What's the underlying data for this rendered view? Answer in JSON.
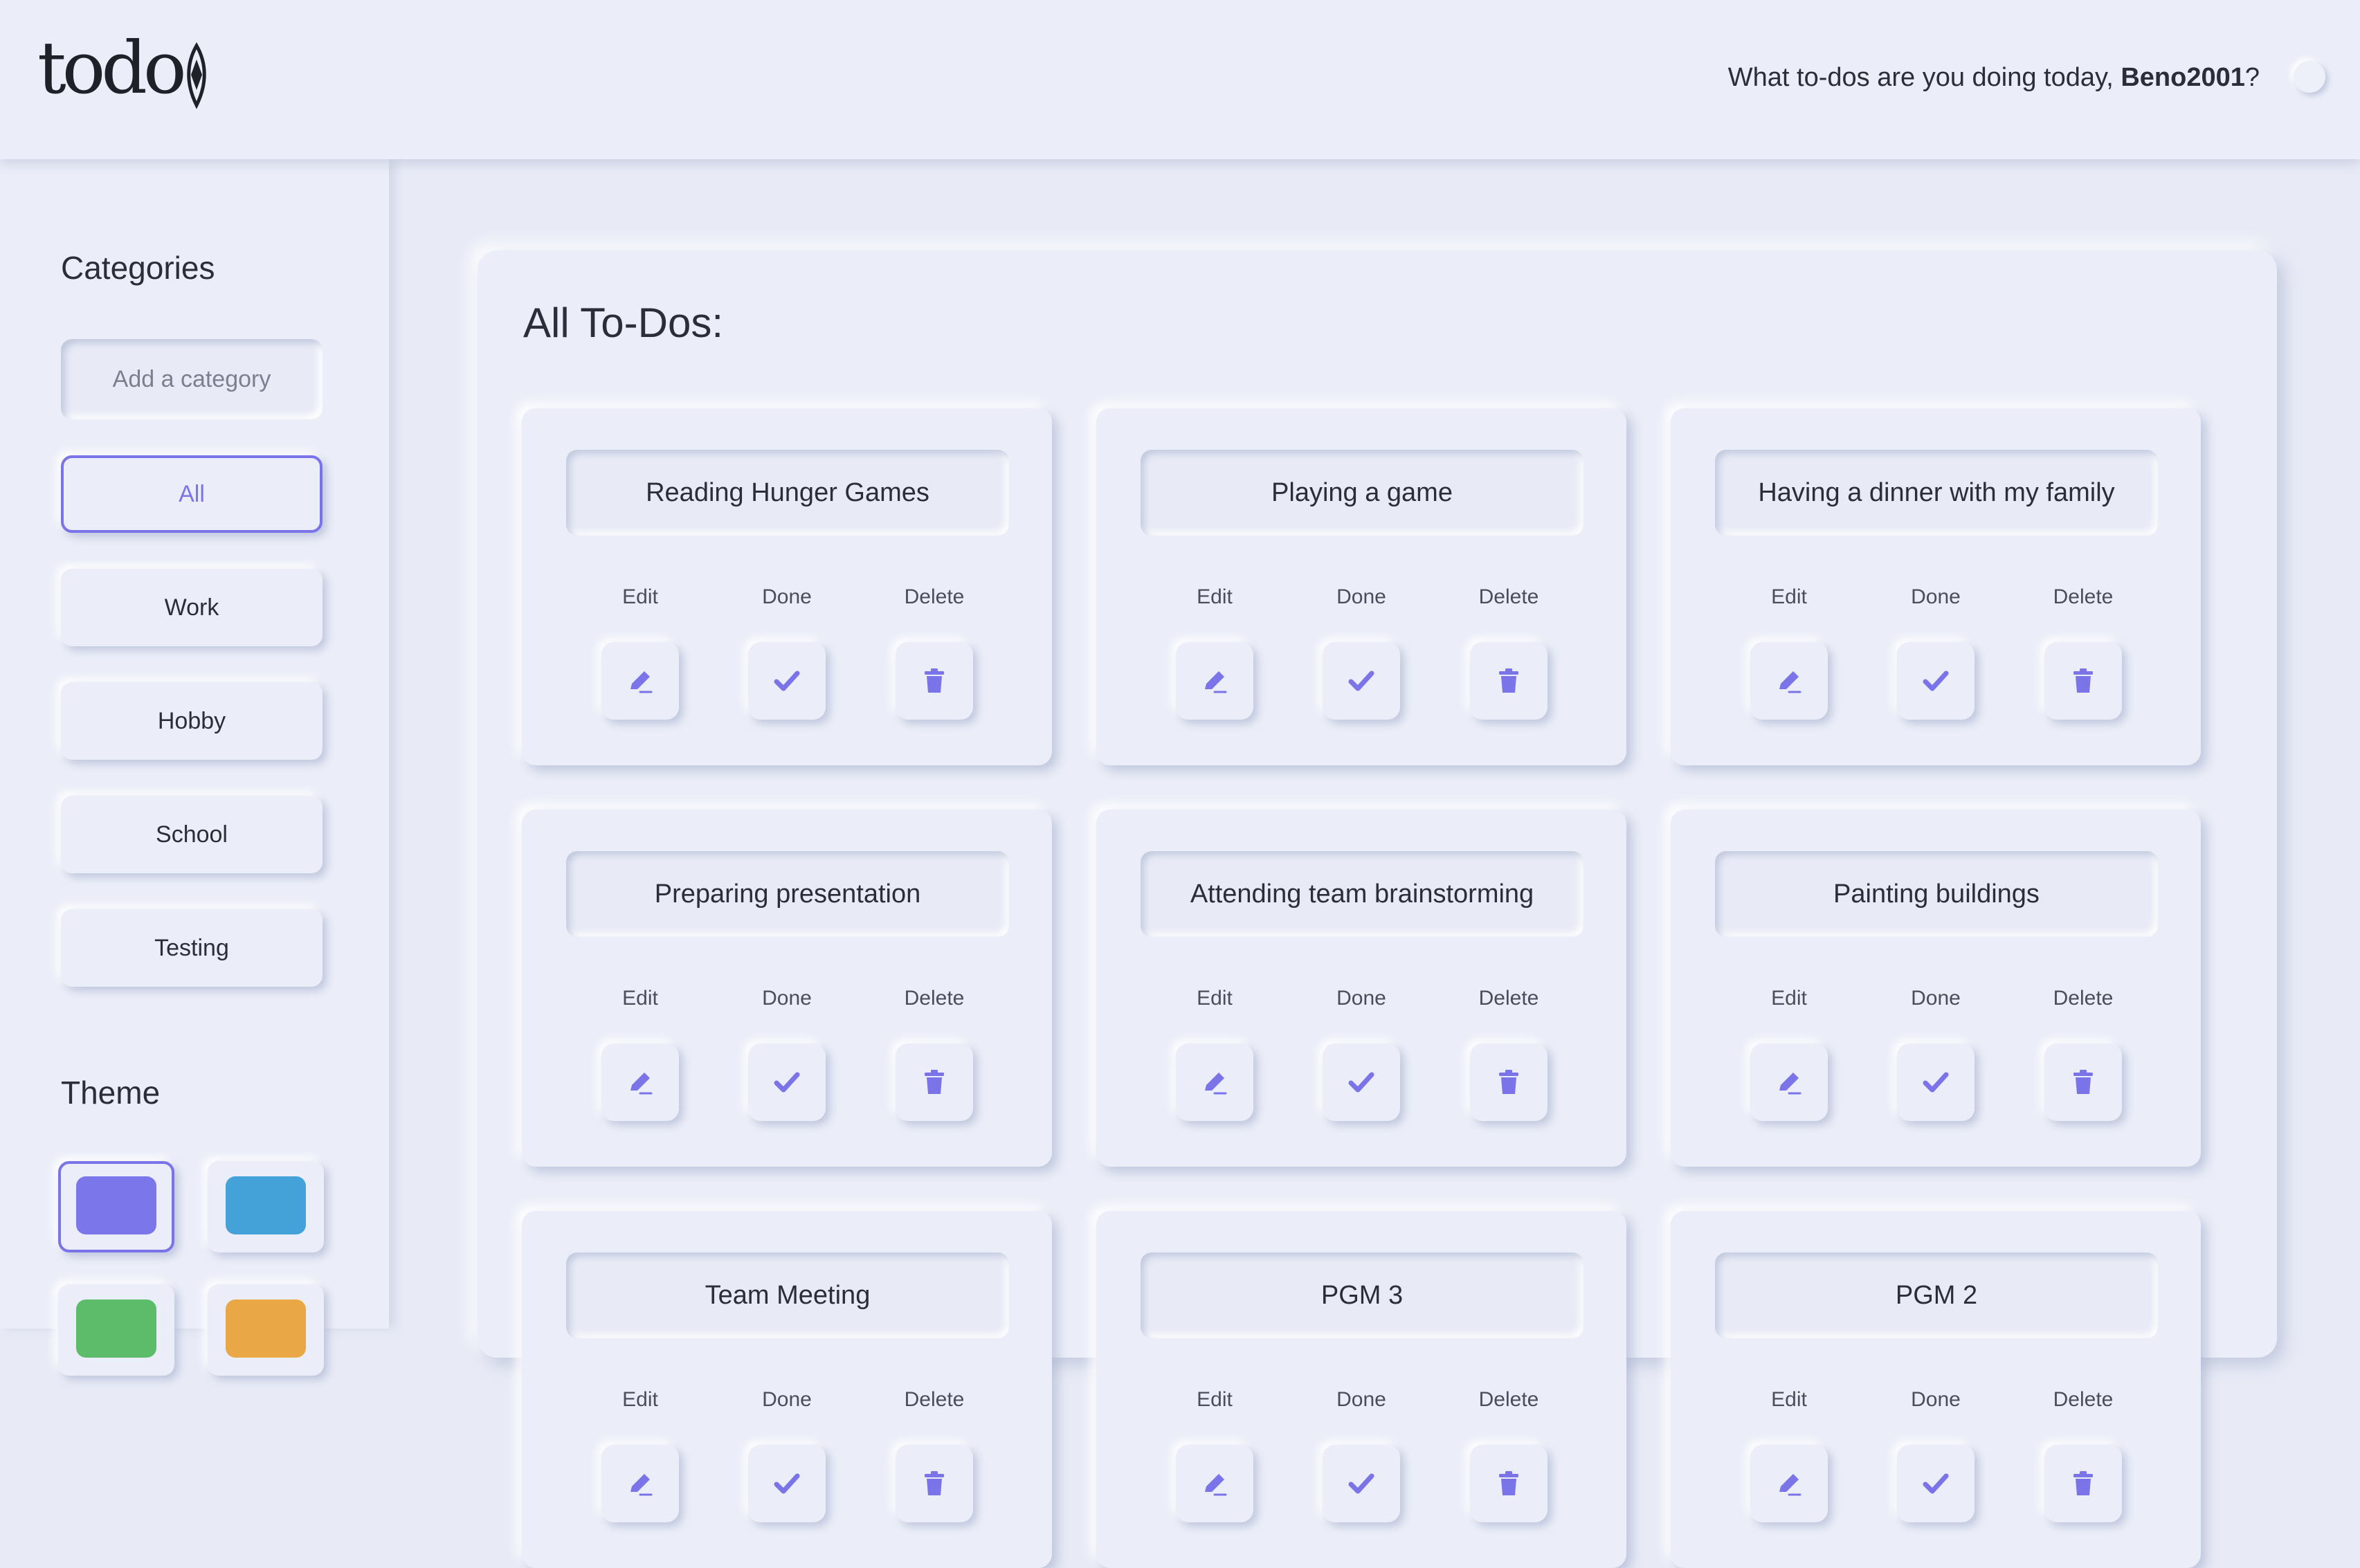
{
  "header": {
    "logo": "todo",
    "greeting_prefix": "What to-dos are you doing today, ",
    "username": "Beno2001",
    "greeting_suffix": "?"
  },
  "sidebar": {
    "categories_title": "Categories",
    "add_category_placeholder": "Add a category",
    "categories": [
      {
        "label": "All",
        "active": true
      },
      {
        "label": "Work",
        "active": false
      },
      {
        "label": "Hobby",
        "active": false
      },
      {
        "label": "School",
        "active": false
      },
      {
        "label": "Testing",
        "active": false
      }
    ],
    "theme_title": "Theme",
    "themes": [
      {
        "color": "#7b76e9",
        "active": true
      },
      {
        "color": "#45a2d8",
        "active": false
      },
      {
        "color": "#5cbc6a",
        "active": false
      },
      {
        "color": "#e9a845",
        "active": false
      }
    ]
  },
  "main": {
    "title": "All To-Dos:",
    "action_labels": {
      "edit": "Edit",
      "done": "Done",
      "delete": "Delete"
    },
    "accent_color": "#7a74e8",
    "todos": [
      {
        "title": "Reading Hunger Games"
      },
      {
        "title": "Playing a game"
      },
      {
        "title": "Having a dinner with my family"
      },
      {
        "title": "Preparing presentation"
      },
      {
        "title": "Attending team brainstorming"
      },
      {
        "title": "Painting buildings"
      },
      {
        "title": "Team Meeting"
      },
      {
        "title": "PGM 3"
      },
      {
        "title": "PGM 2"
      }
    ]
  }
}
